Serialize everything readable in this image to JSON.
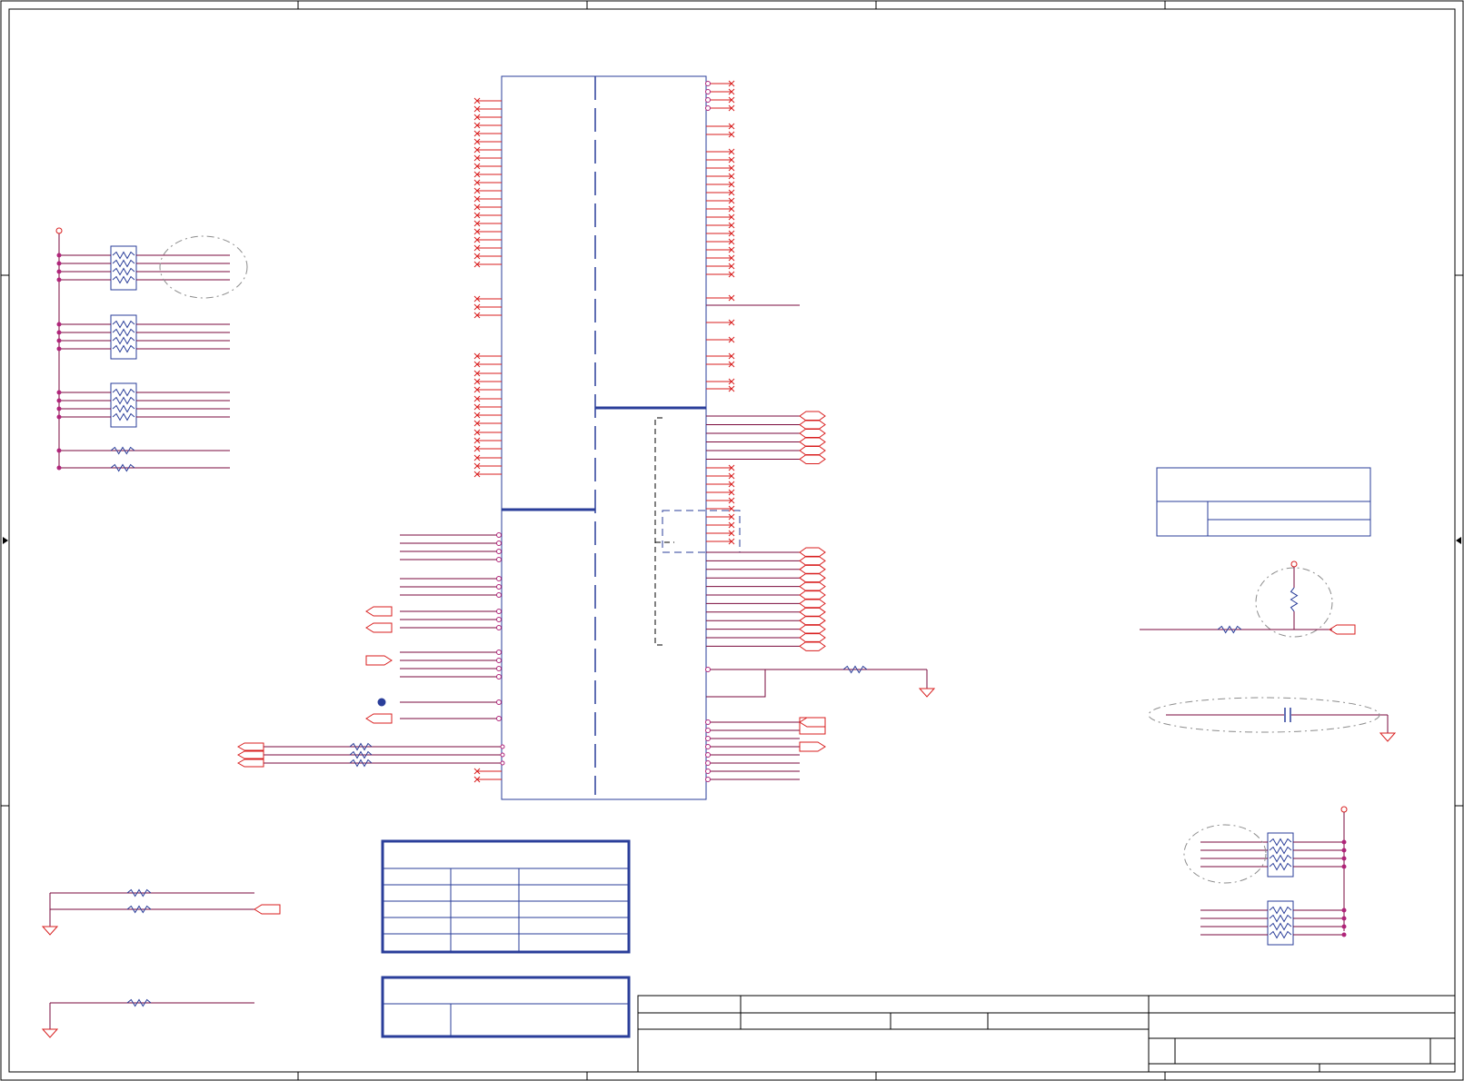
{
  "document": {
    "type": "electronic schematic sheet",
    "text_labels": [],
    "colors": {
      "frame": "#000000",
      "wire": "#d81e1e",
      "net": "#7a0a3c",
      "component": "#2a3e9a",
      "dashed_outline": "#8c8c8c",
      "pin_marker": "#b0257a"
    }
  },
  "icons": [
    "resistor-icon",
    "resistor-network-icon",
    "capacitor-icon",
    "ground-icon",
    "power-rail-icon",
    "port-connector-icon",
    "no-connect-icon",
    "junction-dot-icon"
  ]
}
